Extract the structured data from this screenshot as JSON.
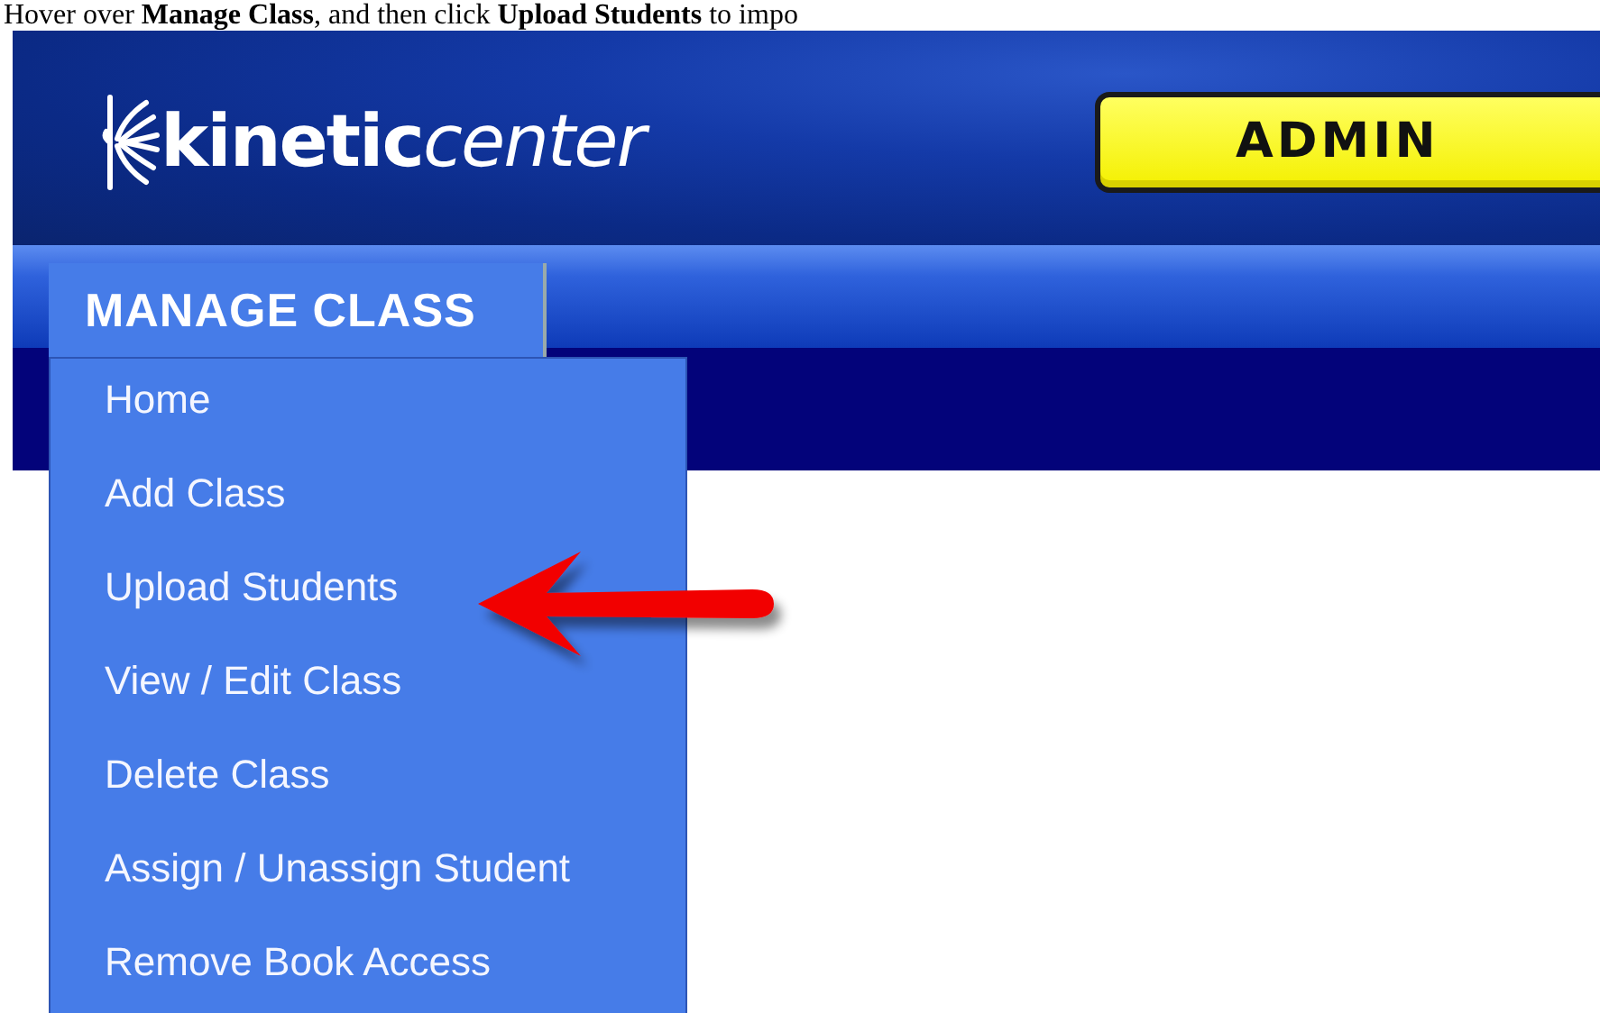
{
  "instruction": "Hover over **Manage Class**, and then click **Upload Students** to impo",
  "header": {
    "logo": {
      "bold": "kinetic",
      "light": "center"
    },
    "role_button": "ADMIN"
  },
  "nav": {
    "menu": {
      "label": "MANAGE CLASS",
      "expanded": true,
      "items": [
        {
          "label": "Home"
        },
        {
          "label": "Add Class"
        },
        {
          "label": "Upload Students"
        },
        {
          "label": "View / Edit Class"
        },
        {
          "label": "Delete Class"
        },
        {
          "label": "Assign / Unassign Student"
        },
        {
          "label": "Remove Book Access"
        }
      ]
    }
  }
}
